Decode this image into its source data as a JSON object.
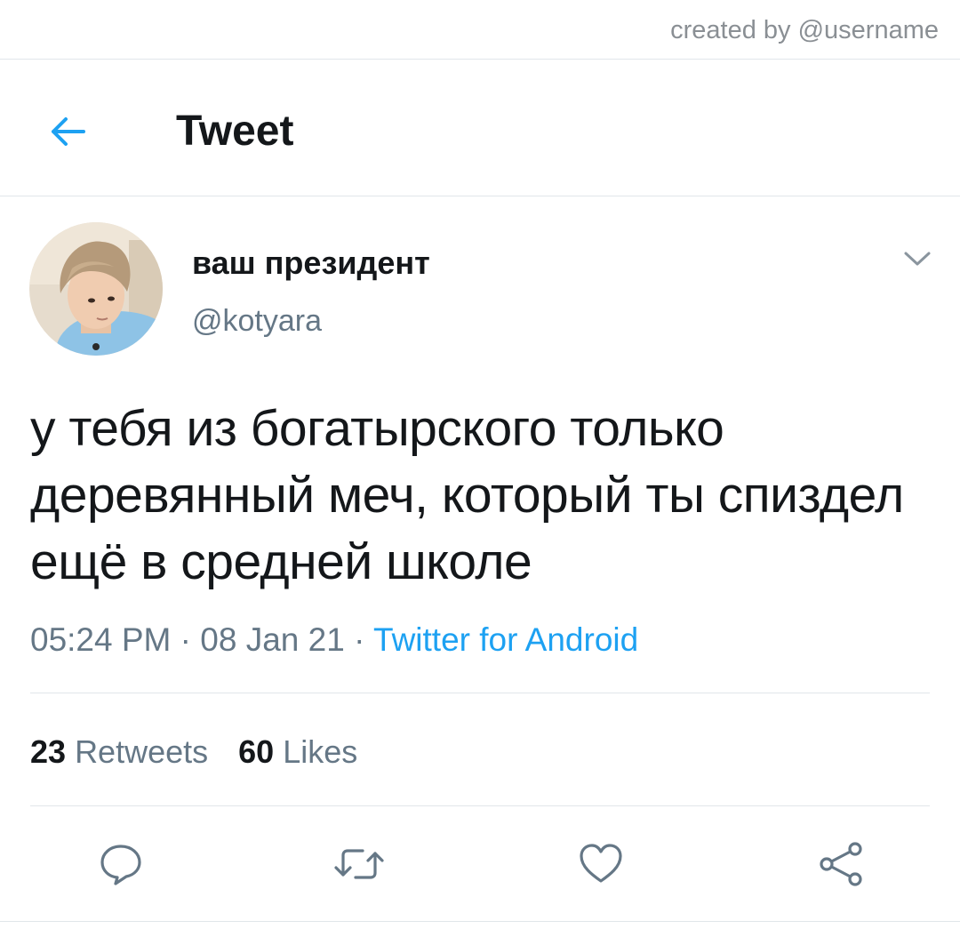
{
  "credit": "created by @username",
  "header": {
    "title": "Tweet",
    "back_icon": "arrow-left-icon",
    "accent_color": "#1da1f2"
  },
  "tweet": {
    "display_name": "ваш президент",
    "handle": "@kotyara",
    "text": "у тебя из богатырского только деревянный меч, который ты спиздел ещё в средней школе",
    "time": "05:24 PM",
    "date": "08 Jan 21",
    "separator": " · ",
    "source": "Twitter for Android",
    "retweets_count": "23",
    "retweets_label": "Retweets",
    "likes_count": "60",
    "likes_label": "Likes"
  },
  "actions": [
    {
      "name": "reply",
      "icon": "reply-icon"
    },
    {
      "name": "retweet",
      "icon": "retweet-icon"
    },
    {
      "name": "like",
      "icon": "heart-icon"
    },
    {
      "name": "share",
      "icon": "share-icon"
    }
  ],
  "colors": {
    "text": "#14171a",
    "secondary": "#657786",
    "divider": "#e1e6ea",
    "link": "#1da1f2"
  }
}
